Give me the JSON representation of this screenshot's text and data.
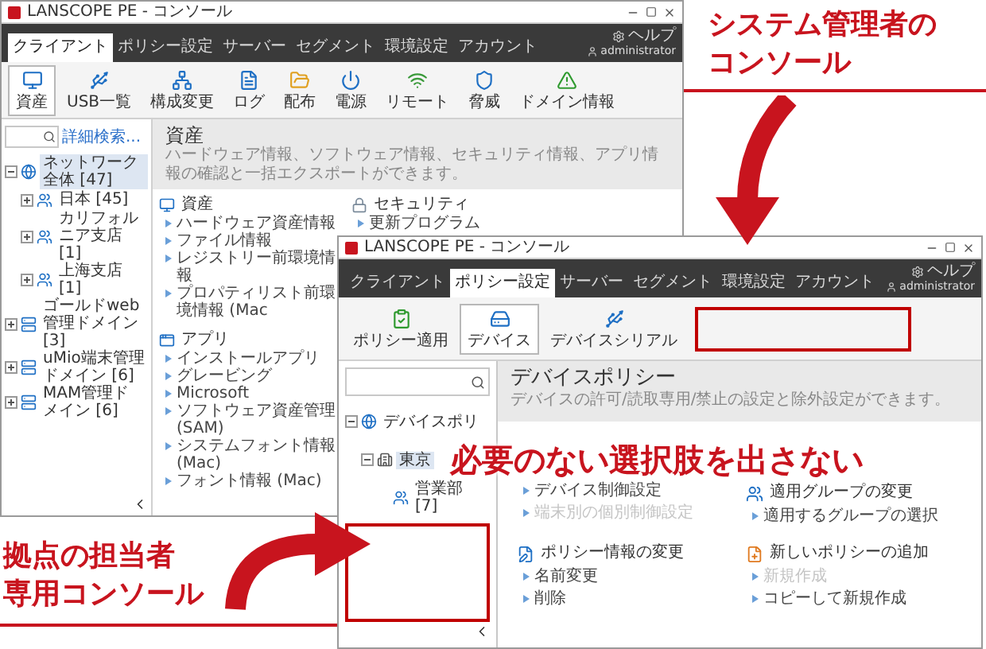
{
  "admin_label": {
    "lines": [
      "システム管理者の",
      "コンソール"
    ]
  },
  "admin_console": {
    "title": "LANSCOPE PE - コンソール",
    "tabs": [
      {
        "label": "クライアント",
        "selected": true
      },
      {
        "label": "ポリシー設定",
        "selected": false
      },
      {
        "label": "サーバー",
        "selected": false
      },
      {
        "label": "セグメント",
        "selected": false
      },
      {
        "label": "環境設定",
        "selected": false
      },
      {
        "label": "アカウント",
        "selected": false
      }
    ],
    "help": "ヘルプ",
    "user": "administrator",
    "toolbar": [
      {
        "label": "資産",
        "kind": "monitor",
        "selected": true
      },
      {
        "label": "USB一覧",
        "kind": "usb",
        "selected": false
      },
      {
        "label": "構成変更",
        "kind": "network",
        "selected": false
      },
      {
        "label": "ログ",
        "kind": "log",
        "selected": false
      },
      {
        "label": "配布",
        "kind": "folder",
        "selected": false
      },
      {
        "label": "電源",
        "kind": "power",
        "selected": false
      },
      {
        "label": "リモート",
        "kind": "remote",
        "selected": false
      },
      {
        "label": "脅威",
        "kind": "shield",
        "selected": false
      },
      {
        "label": "ドメイン情報",
        "kind": "warning",
        "selected": false
      }
    ],
    "advanced_search_link": "詳細検索...",
    "tree": [
      {
        "label": "ネットワーク全体 [47]",
        "kind": "globe",
        "selected": true,
        "expanded": true,
        "children": [
          {
            "label": "日本 [45]",
            "kind": "group",
            "selected": false,
            "expanded": false
          },
          {
            "label": "カリフォルニア支店 [1]",
            "kind": "group",
            "selected": false,
            "expanded": false
          },
          {
            "label": "上海支店 [1]",
            "kind": "group",
            "selected": false,
            "expanded": false
          }
        ]
      },
      {
        "label": "ゴールドweb管理ドメイン [3]",
        "kind": "domain",
        "selected": false,
        "expanded": false
      },
      {
        "label": "uMio端末管理ドメイン [6]",
        "kind": "domain",
        "selected": false,
        "expanded": false
      },
      {
        "label": "MAM管理ドメイン [6]",
        "kind": "domain",
        "selected": false,
        "expanded": false
      }
    ],
    "page": {
      "title": "資産",
      "description": "ハードウェア情報、ソフトウェア情報、セキュリティ情報、アプリ情報の確認と一括エクスポートができます。"
    },
    "columns": [
      [
        {
          "title": "資産",
          "kind": "monitor",
          "items": [
            "ハードウェア資産情報",
            "ファイル情報",
            "レジストリー前環境情報",
            "プロパティリスト前環境情報 (Mac"
          ]
        },
        {
          "title": "アプリ",
          "kind": "app",
          "items": [
            "インストールアプリ",
            "グレービング",
            "Microsoft",
            "ソフトウェア資産管理 (SAM)",
            "システムフォント情報 (Mac)",
            "フォント情報 (Mac)"
          ]
        }
      ],
      [
        {
          "title": "セキュリティ",
          "kind": "lock",
          "items": [
            "更新プログラム"
          ]
        }
      ]
    ]
  },
  "branch_console": {
    "title": "LANSCOPE PE - コンソール",
    "tabs": [
      {
        "label": "クライアント",
        "selected": false
      },
      {
        "label": "ポリシー設定",
        "selected": true
      },
      {
        "label": "サーバー",
        "selected": false
      },
      {
        "label": "セグメント",
        "selected": false
      },
      {
        "label": "環境設定",
        "selected": false
      },
      {
        "label": "アカウント",
        "selected": false
      }
    ],
    "help": "ヘルプ",
    "user": "administrator",
    "toolbar": [
      {
        "label": "ポリシー適用",
        "kind": "policy",
        "selected": false
      },
      {
        "label": "デバイス",
        "kind": "device",
        "selected": true
      },
      {
        "label": "デバイスシリアル",
        "kind": "usb",
        "selected": false
      }
    ],
    "tree": [
      {
        "label": "デバイスポリ",
        "kind": "globe",
        "selected": false,
        "expanded": true,
        "children": [
          {
            "label": "東京",
            "kind": "building",
            "selected": true,
            "expanded": true,
            "children": [
              {
                "label": "営業部 [7]",
                "kind": "group",
                "selected": false
              }
            ]
          }
        ]
      }
    ],
    "page": {
      "title": "デバイスポリシー",
      "description": "デバイスの許可/読取専用/禁止の設定と除外設定ができます。"
    },
    "groups": [
      {
        "items": [
          {
            "label": "デバイス制御設定",
            "disabled": false
          },
          {
            "label": "端末別の個別制御設定",
            "disabled": true
          }
        ]
      },
      {
        "title": "適用グループの変更",
        "kind": "group",
        "items": [
          {
            "label": "適用するグループの選択",
            "disabled": false
          }
        ]
      },
      {
        "title": "ポリシー情報の変更",
        "kind": "edit",
        "items": [
          {
            "label": "名前変更",
            "disabled": false
          },
          {
            "label": "削除",
            "disabled": false
          }
        ]
      },
      {
        "title": "新しいポリシーの追加",
        "kind": "add",
        "items": [
          {
            "label": "新規作成",
            "disabled": true
          },
          {
            "label": "コピーして新規作成",
            "disabled": false
          }
        ]
      }
    ]
  },
  "callout": "必要のない選択肢を出さない",
  "branch_label": {
    "lines": [
      "拠点の担当者",
      "専用コンソール"
    ]
  }
}
